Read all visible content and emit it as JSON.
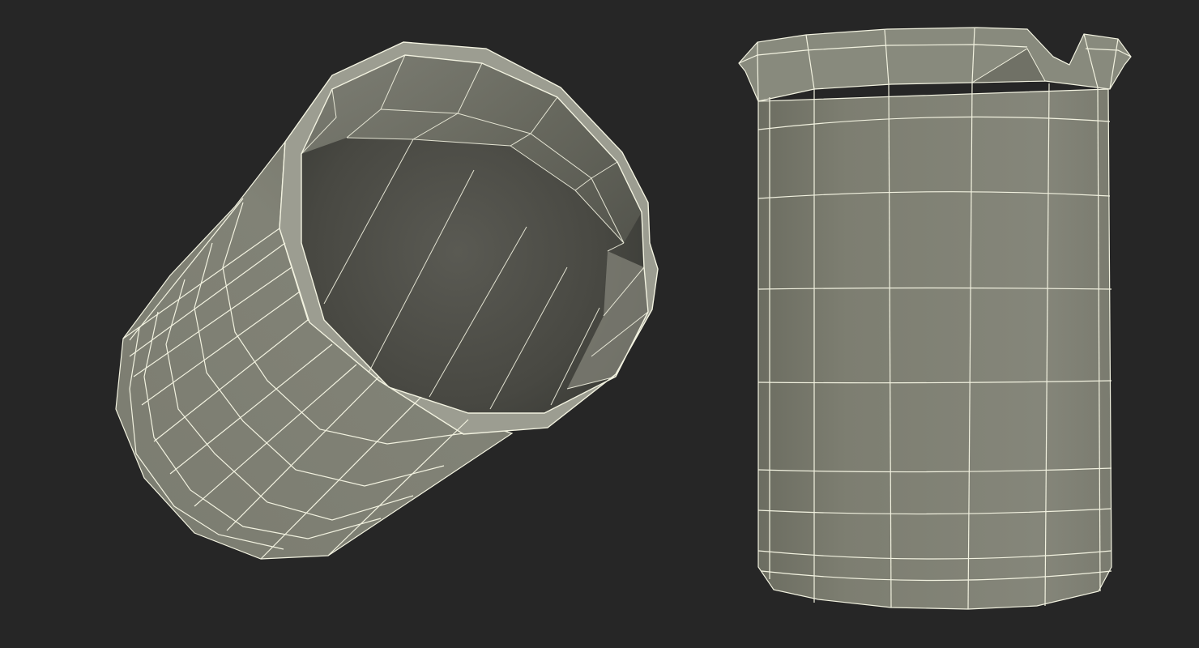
{
  "scene": {
    "background": "#262626",
    "mesh_fill": "#7b7c6f",
    "mesh_fill_dark": "#4a4a44",
    "wire_color": "#f2f2e0"
  },
  "views": [
    {
      "name": "tilted-view",
      "subject": "beaker-wireframe"
    },
    {
      "name": "front-view",
      "subject": "beaker-wireframe"
    }
  ]
}
